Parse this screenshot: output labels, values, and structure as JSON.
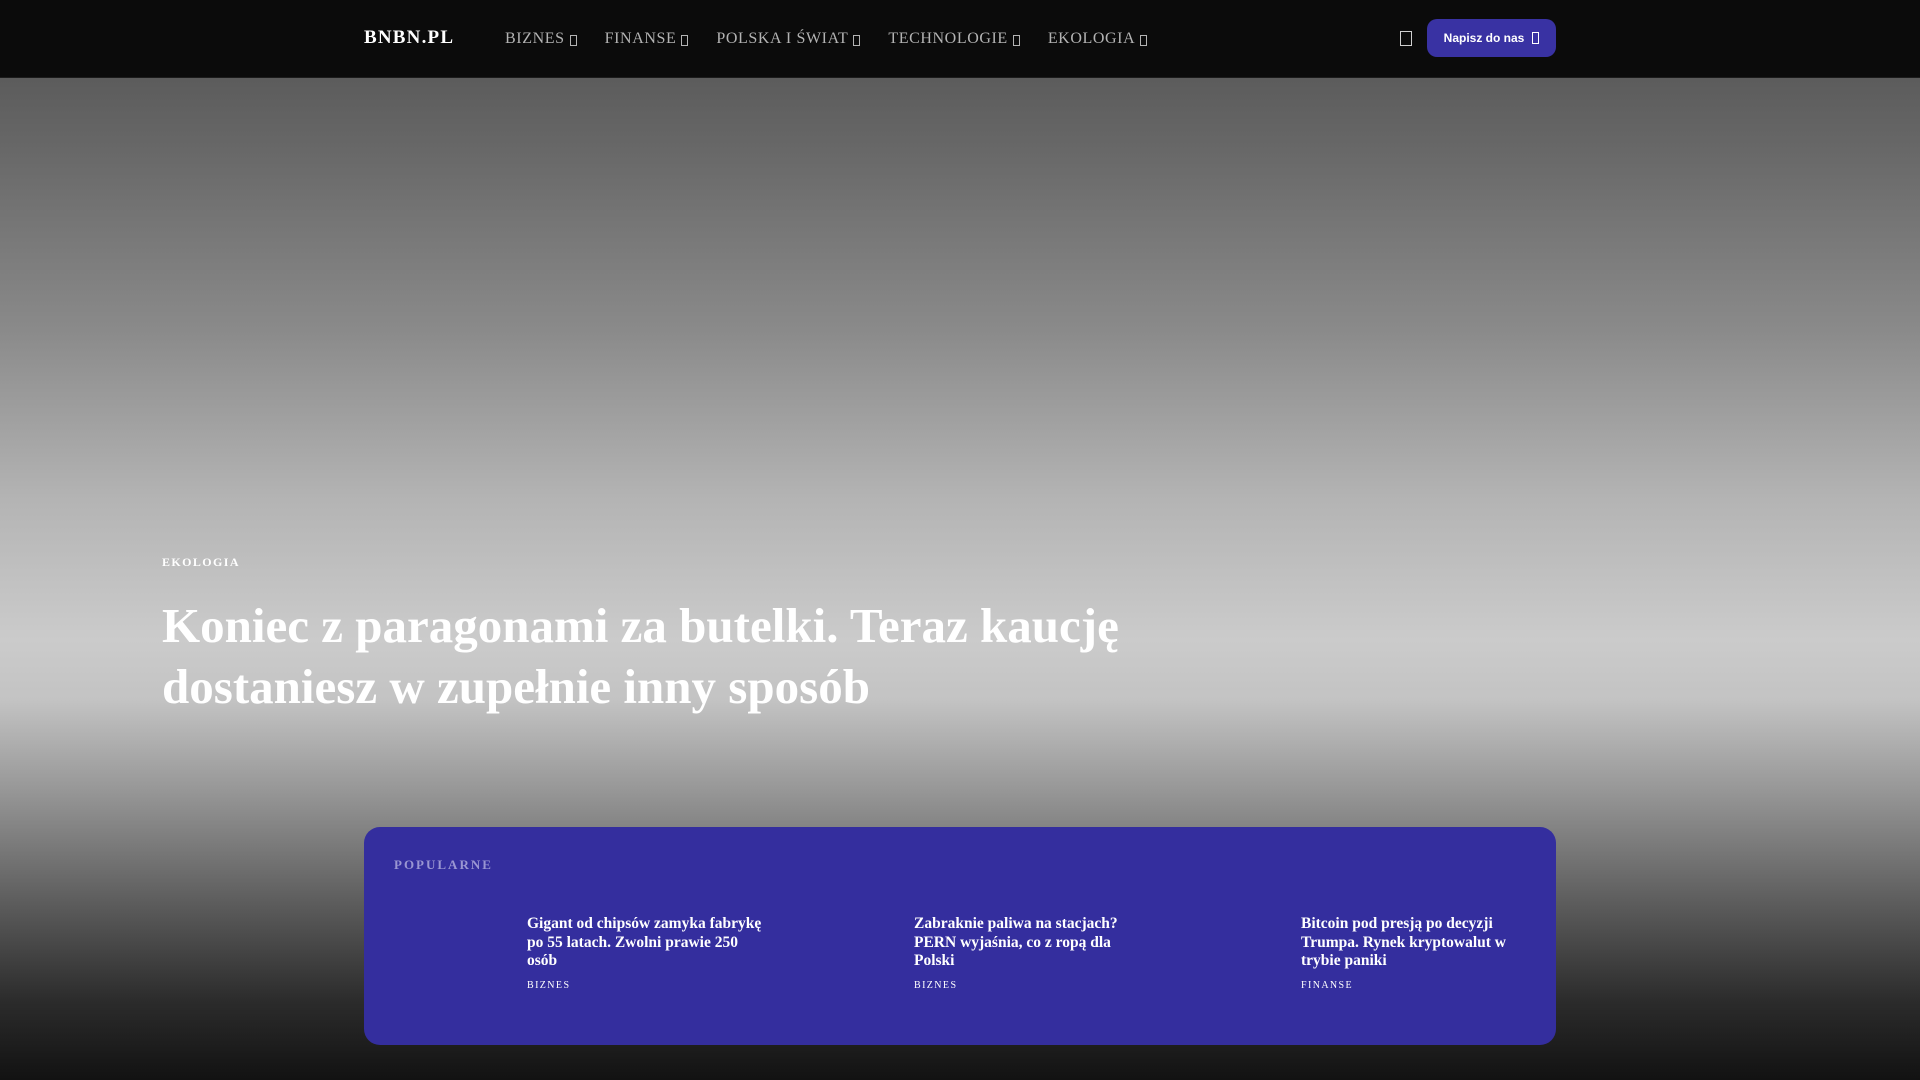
{
  "site": {
    "logo": "BNBN.PL"
  },
  "nav": {
    "items": [
      {
        "label": "BIZNES"
      },
      {
        "label": "FINANSE"
      },
      {
        "label": "POLSKA I ŚWIAT"
      },
      {
        "label": "TECHNOLOGIE"
      },
      {
        "label": "EKOLOGIA"
      }
    ],
    "search_icon": "search-icon",
    "contact_label": "Napisz do nas"
  },
  "hero": {
    "category": "EKOLOGIA",
    "title": "Koniec z paragonami za butelki. Teraz kaucję dostaniesz w zupełnie inny sposób"
  },
  "popular": {
    "label": "POPULARNE",
    "items": [
      {
        "title": "Gigant od chipsów zamyka fabrykę po 55 latach. Zwolni prawie 250 osób",
        "category": "BIZNES"
      },
      {
        "title": "Zabraknie paliwa na stacjach? PERN wyjaśnia, co z ropą dla Polski",
        "category": "BIZNES"
      },
      {
        "title": "Bitcoin pod presją po decyzji Trumpa. Rynek kryptowalut w trybie paniki",
        "category": "FINANSE"
      }
    ]
  },
  "colors": {
    "navbar_bg": "#0b0b0b",
    "accent": "#3932a3",
    "panel_bg": "#342e9e",
    "panel_label": "#9a96d2"
  }
}
